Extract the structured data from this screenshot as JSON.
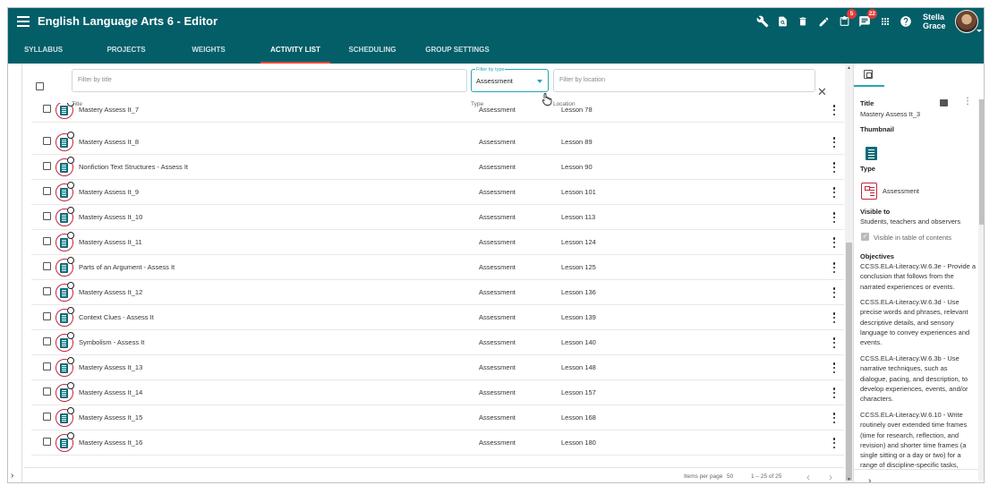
{
  "app": {
    "title": "English Language Arts 6 - Editor"
  },
  "user": {
    "first": "Stella",
    "last": "Grace"
  },
  "badges": {
    "clipboard": "5",
    "chat": "22"
  },
  "tabs": [
    {
      "label": "SYLLABUS"
    },
    {
      "label": "PROJECTS"
    },
    {
      "label": "WEIGHTS"
    },
    {
      "label": "ACTIVITY LIST",
      "active": true
    },
    {
      "label": "SCHEDULING"
    },
    {
      "label": "GROUP SETTINGS"
    }
  ],
  "filters": {
    "title_placeholder": "Filter by title",
    "type_label": "Filter by type",
    "type_value": "Assessment",
    "location_placeholder": "Filter by location"
  },
  "columns": {
    "title": "Title",
    "type": "Type",
    "location": "Location"
  },
  "rows": [
    {
      "title": "Mastery Assess It_7",
      "type": "Assessment",
      "location": "Lesson 78"
    },
    {
      "title": "Mastery Assess It_8",
      "type": "Assessment",
      "location": "Lesson 89"
    },
    {
      "title": "Nonfiction Text Structures - Assess It",
      "type": "Assessment",
      "location": "Lesson 90"
    },
    {
      "title": "Mastery Assess It_9",
      "type": "Assessment",
      "location": "Lesson 101"
    },
    {
      "title": "Mastery Assess It_10",
      "type": "Assessment",
      "location": "Lesson 113"
    },
    {
      "title": "Mastery Assess It_11",
      "type": "Assessment",
      "location": "Lesson 124"
    },
    {
      "title": "Parts of an Argument - Assess It",
      "type": "Assessment",
      "location": "Lesson 125"
    },
    {
      "title": "Mastery Assess It_12",
      "type": "Assessment",
      "location": "Lesson 136"
    },
    {
      "title": "Context Clues - Assess It",
      "type": "Assessment",
      "location": "Lesson 139"
    },
    {
      "title": "Symbolism - Assess It",
      "type": "Assessment",
      "location": "Lesson 140"
    },
    {
      "title": "Mastery Assess It_13",
      "type": "Assessment",
      "location": "Lesson 148"
    },
    {
      "title": "Mastery Assess It_14",
      "type": "Assessment",
      "location": "Lesson 157"
    },
    {
      "title": "Mastery Assess It_15",
      "type": "Assessment",
      "location": "Lesson 168"
    },
    {
      "title": "Mastery Assess It_16",
      "type": "Assessment",
      "location": "Lesson 180"
    }
  ],
  "pagination": {
    "items_per_page_label": "Items per page",
    "items_per_page": "50",
    "range": "1 – 25 of 25"
  },
  "detail": {
    "title_label": "Title",
    "title_value": "Mastery Assess It_3",
    "thumbnail_label": "Thumbnail",
    "type_label": "Type",
    "type_value": "Assessment",
    "visible_label": "Visible to",
    "visible_value": "Students, teachers and observers",
    "toc_label": "Visible in table of contents",
    "objectives_label": "Objectives",
    "objectives": [
      "CCSS.ELA-Literacy.W.6.3e - Provide a conclusion that follows from the narrated experiences or events.",
      "CCSS.ELA-Literacy.W.6.3d - Use precise words and phrases, relevant descriptive details, and sensory language to convey experiences and events.",
      "CCSS.ELA-Literacy.W.6.3b - Use narrative techniques, such as dialogue, pacing, and description, to develop experiences, events, and/or characters.",
      "CCSS.ELA-Literacy.W.6.10 - Write routinely over extended time frames (time for research, reflection, and revision) and shorter time frames (a single sitting or a day or two) for a range of discipline-specific tasks,"
    ]
  },
  "colors": {
    "header": "#035e68",
    "accent": "#2aa4b5",
    "active_tab_underline": "#e24a3b",
    "assessment": "#c0253c",
    "badge": "#e53935"
  },
  "icons": [
    "menu-icon",
    "wrench-icon",
    "search-doc-icon",
    "trash-icon",
    "pencil-icon",
    "clipboard-icon",
    "chat-icon",
    "apps-grid-icon",
    "help-icon"
  ]
}
